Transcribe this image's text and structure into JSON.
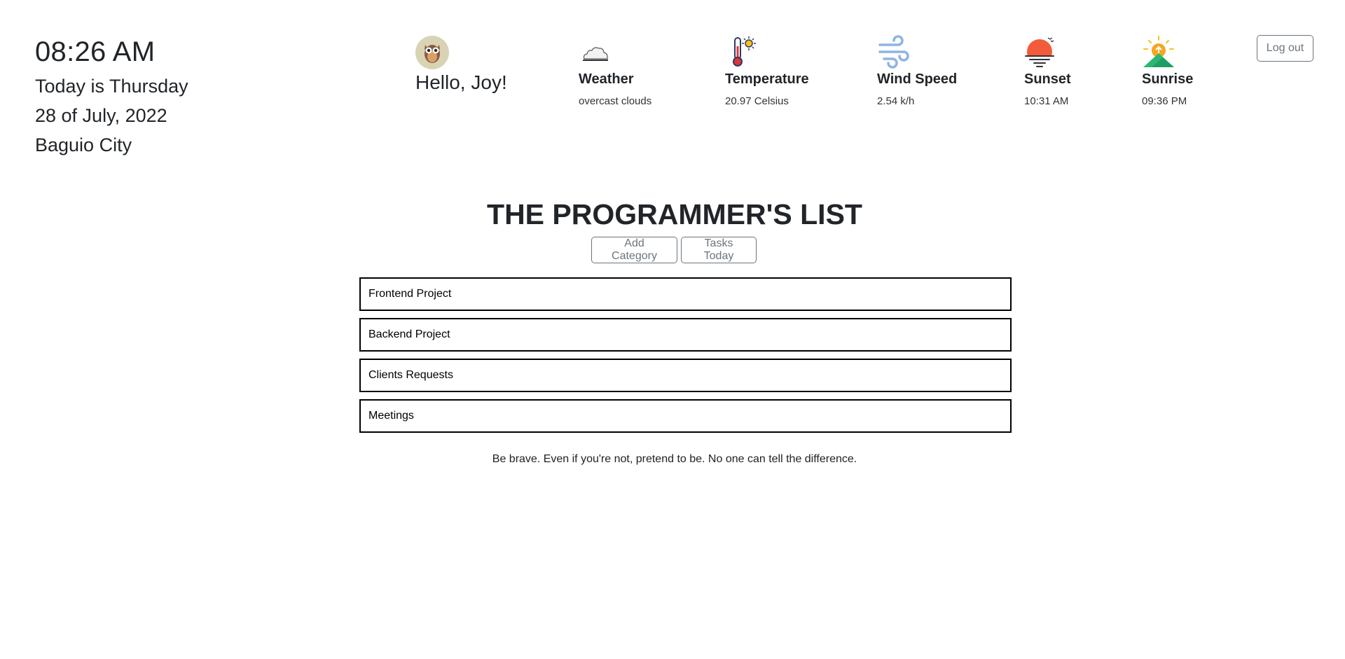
{
  "header": {
    "time": "08:26 AM",
    "day": "Today is Thursday",
    "date": "28 of July, 2022",
    "city": "Baguio City"
  },
  "user": {
    "greeting": "Hello, Joy!",
    "avatar_icon": "owl-avatar-icon"
  },
  "weather": {
    "items": [
      {
        "label": "Weather",
        "value": "overcast clouds",
        "icon": "cloud-icon"
      },
      {
        "label": "Temperature",
        "value": "20.97 Celsius",
        "icon": "thermometer-icon"
      },
      {
        "label": "Wind Speed",
        "value": "2.54 k/h",
        "icon": "wind-icon"
      },
      {
        "label": "Sunset",
        "value": "10:31 AM",
        "icon": "sunset-icon"
      },
      {
        "label": "Sunrise",
        "value": "09:36 PM",
        "icon": "sunrise-icon"
      }
    ]
  },
  "actions": {
    "logout_label": "Log out"
  },
  "main": {
    "title": "THE PROGRAMMER'S LIST",
    "add_category_label": "Add Category",
    "tasks_today_label": "Tasks Today",
    "categories": [
      "Frontend Project",
      "Backend Project",
      "Clients Requests",
      "Meetings"
    ],
    "quote": "Be brave. Even if you're not, pretend to be. No one can tell the difference."
  },
  "colors": {
    "text": "#212529",
    "button_border": "#6c757d",
    "sunset_red": "#f25c3b",
    "sunrise_orange": "#f5a623",
    "wind_blue": "#8fb4e0"
  }
}
